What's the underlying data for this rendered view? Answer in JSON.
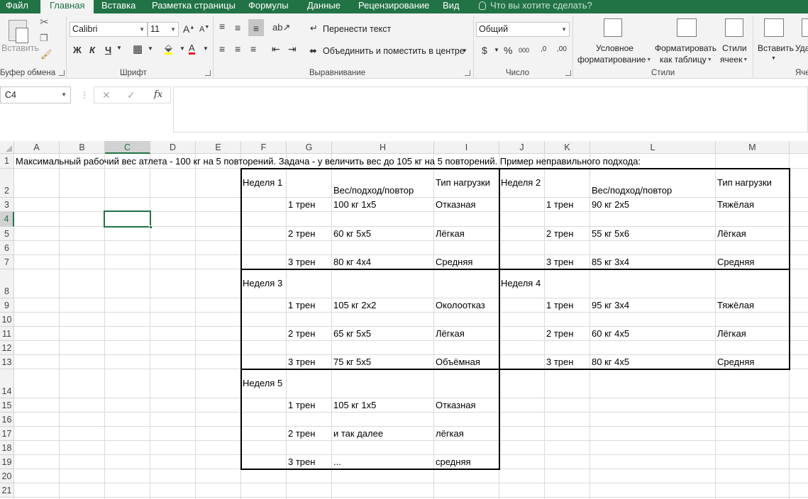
{
  "ribbon_tabs": [
    "Файл",
    "Главная",
    "Вставка",
    "Разметка страницы",
    "Формулы",
    "Данные",
    "Рецензирование",
    "Вид"
  ],
  "active_tab": "Главная",
  "tell_me": "Что вы хотите сделать?",
  "clipboard": {
    "paste": "Вставить",
    "group": "Буфер обмена"
  },
  "font": {
    "name": "Calibri",
    "size": "11",
    "bold": "Ж",
    "italic": "К",
    "underline": "Ч",
    "grow": "A",
    "shrink": "A",
    "group": "Шрифт"
  },
  "alignment": {
    "wrap": "Перенести текст",
    "merge": "Объединить и поместить в центре",
    "group": "Выравнивание"
  },
  "number": {
    "format": "Общий",
    "currency": "$",
    "percent": "%",
    "thousands": "000",
    "inc": ",0",
    "dec": ",00",
    "group": "Число"
  },
  "styles": {
    "conditional_1": "Условное",
    "conditional_2": "форматирование",
    "table_1": "Форматировать",
    "table_2": "как таблицу",
    "cell_1": "Стили",
    "cell_2": "ячеек",
    "group": "Стили"
  },
  "cells": {
    "insert": "Вставить",
    "delete": "Уда",
    "group": "Яче"
  },
  "formula_bar": {
    "name_box": "C4",
    "fx": "fx",
    "cancel": "✕",
    "enter": "✓",
    "value": ""
  },
  "columns": [
    "A",
    "B",
    "C",
    "D",
    "E",
    "F",
    "G",
    "H",
    "I",
    "J",
    "K",
    "L",
    "M"
  ],
  "selected_column": "C",
  "rows": [
    "1",
    "2",
    "3",
    "4",
    "5",
    "6",
    "7",
    "8",
    "9",
    "10",
    "11",
    "12",
    "13",
    "14",
    "15",
    "16",
    "17",
    "18",
    "19",
    "20",
    "21"
  ],
  "selected_row": "4",
  "sheet": {
    "title": "Максимальный рабочий вес атлета - 100 кг на 5 повторений. Задача - у величить вес до 105 кг на 5 повторений. Пример неправильного подхода:",
    "weeks": [
      {
        "label": "Неделя 1",
        "header_weight": "Вес/подход/повтор",
        "header_type": "Тип нагрузки",
        "sessions": [
          {
            "n": "1 трен",
            "w": "100 кг 1х5",
            "t": "Отказная"
          },
          {
            "n": "2 трен",
            "w": "60 кг 5х5",
            "t": "Лёгкая"
          },
          {
            "n": "3 трен",
            "w": "80 кг 4х4",
            "t": "Средняя"
          }
        ]
      },
      {
        "label": "Неделя 2",
        "header_weight": "Вес/подход/повтор",
        "header_type": "Тип нагрузки",
        "sessions": [
          {
            "n": "1 трен",
            "w": "90 кг 2х5",
            "t": "Тяжёлая"
          },
          {
            "n": "2 трен",
            "w": "55 кг 5х6",
            "t": "Лёгкая"
          },
          {
            "n": "3 трен",
            "w": "85 кг 3х4",
            "t": "Средняя"
          }
        ]
      },
      {
        "label": "Неделя 3",
        "sessions": [
          {
            "n": "1 трен",
            "w": "105 кг 2х2",
            "t": "Околоотказ"
          },
          {
            "n": "2 трен",
            "w": "65 кг 5х5",
            "t": "Лёгкая"
          },
          {
            "n": "3 трен",
            "w": "75 кг 5х5",
            "t": "Объёмная"
          }
        ]
      },
      {
        "label": "Неделя 4",
        "sessions": [
          {
            "n": "1 трен",
            "w": "95 кг 3х4",
            "t": "Тяжёлая"
          },
          {
            "n": "2 трен",
            "w": "60 кг 4х5",
            "t": "Лёгкая"
          },
          {
            "n": "3 трен",
            "w": "80 кг 4х5",
            "t": "Средняя"
          }
        ]
      },
      {
        "label": "Неделя 5",
        "sessions": [
          {
            "n": "1 трен",
            "w": "105 кг 1х5",
            "t": "Отказная"
          },
          {
            "n": "2 трен",
            "w": "и так далее",
            "t": "лёгкая"
          },
          {
            "n": "3 трен",
            "w": "...",
            "t": "средняя"
          }
        ]
      }
    ]
  },
  "colors": {
    "accent": "#217346",
    "ribbon_bg": "#f3f3f3",
    "grid_line": "#dadada"
  }
}
